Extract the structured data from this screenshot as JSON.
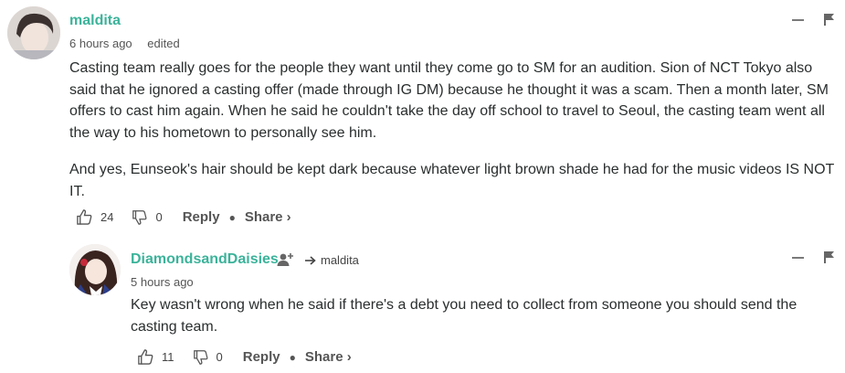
{
  "comments": [
    {
      "username": "maldita",
      "time": "6 hours ago",
      "edited": "edited",
      "paragraphs": [
        "Casting team really goes for the people they want until they come go to SM for an audition. Sion of NCT Tokyo also said that he ignored a casting offer (made through IG DM) because he thought it was a scam. Then a month later, SM offers to cast him again. When he said he couldn't take the day off school to travel to Seoul, the casting team went all the way to his hometown to personally see him.",
        "And yes, Eunseok's hair should be kept dark because whatever light brown shade he had for the music videos IS NOT IT."
      ],
      "upvotes": "24",
      "downvotes": "0",
      "reply_label": "Reply",
      "share_label": "Share ›"
    },
    {
      "username": "DiamondsandDaisies",
      "reply_to": "maldita",
      "time": "5 hours ago",
      "paragraphs": [
        "Key wasn't wrong when he said if there's a debt you need to collect from someone you should send the casting team."
      ],
      "upvotes": "11",
      "downvotes": "0",
      "reply_label": "Reply",
      "share_label": "Share ›"
    }
  ],
  "colors": {
    "username": "#3bb39a",
    "text": "#2a2e2e"
  },
  "icons": [
    "thumbs-up-icon",
    "thumbs-down-icon",
    "minimize-icon",
    "flag-icon",
    "follow-user-icon",
    "reply-arrow-icon"
  ]
}
